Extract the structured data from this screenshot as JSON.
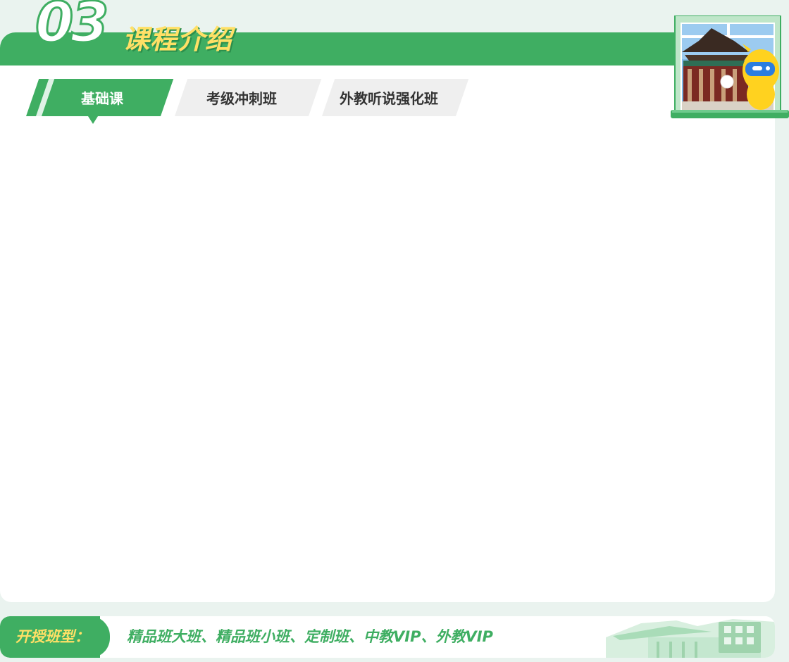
{
  "section": {
    "number": "03",
    "title": "课程介绍"
  },
  "tabs": [
    {
      "label": "基础课",
      "active": true
    },
    {
      "label": "考级冲刺班",
      "active": false
    },
    {
      "label": "外教听说强化班",
      "active": false
    }
  ],
  "footer": {
    "label": "开授班型：",
    "classes": "精品班大班、精品班小班、定制班、中教VIP、外教VIP"
  },
  "colors": {
    "brand_green": "#3fae62",
    "accent_yellow": "#ffe066",
    "page_bg": "#eaf3ef",
    "tab_inactive_bg": "#efefef"
  },
  "icons": {
    "illustration": "window-palace-mascot-illustration",
    "footer_decoration": "palace-building-decoration"
  }
}
